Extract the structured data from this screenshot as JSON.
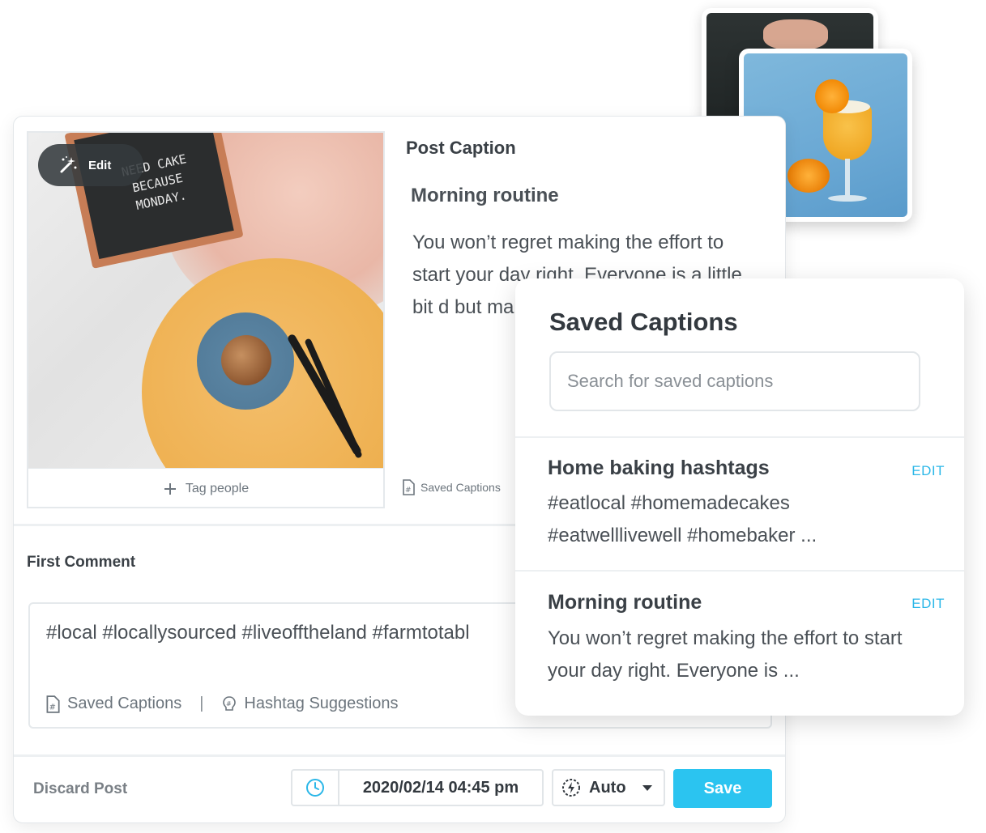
{
  "post": {
    "edit_label": "Edit",
    "tag_people_label": "Tag people",
    "letterboard_text": "NEED CAKE BECAUSE MONDAY.",
    "caption_section_title": "Post Caption",
    "caption_heading": "Morning routine",
    "caption_body": "You won’t regret making the effort to start your day right. Everyone is a little bit d but make s something",
    "saved_captions_link": "Saved Captions"
  },
  "first_comment": {
    "label": "First Comment",
    "text": "#local #locallysourced #liveofftheland #farmtotabl",
    "saved_captions_label": "Saved Captions",
    "separator": "|",
    "hashtag_suggestions_label": "Hashtag Suggestions"
  },
  "footer": {
    "discard_label": "Discard Post",
    "datetime": "2020/02/14 04:45 pm",
    "mode": "Auto",
    "save_label": "Save"
  },
  "saved_captions": {
    "title": "Saved Captions",
    "search_placeholder": "Search for saved captions",
    "items": [
      {
        "title": "Home baking hashtags",
        "edit_label": "EDIT",
        "body": "#eatlocal #homemadecakes #eatwelllivewell #homebaker ..."
      },
      {
        "title": "Morning routine",
        "edit_label": "EDIT",
        "body": "You won’t regret making the effort to start your day right. Everyone is ..."
      }
    ]
  },
  "colors": {
    "accent": "#2bc4f0",
    "edit_link": "#2bb7e8",
    "text_dark": "#33393f",
    "text_muted": "#6c757d"
  }
}
